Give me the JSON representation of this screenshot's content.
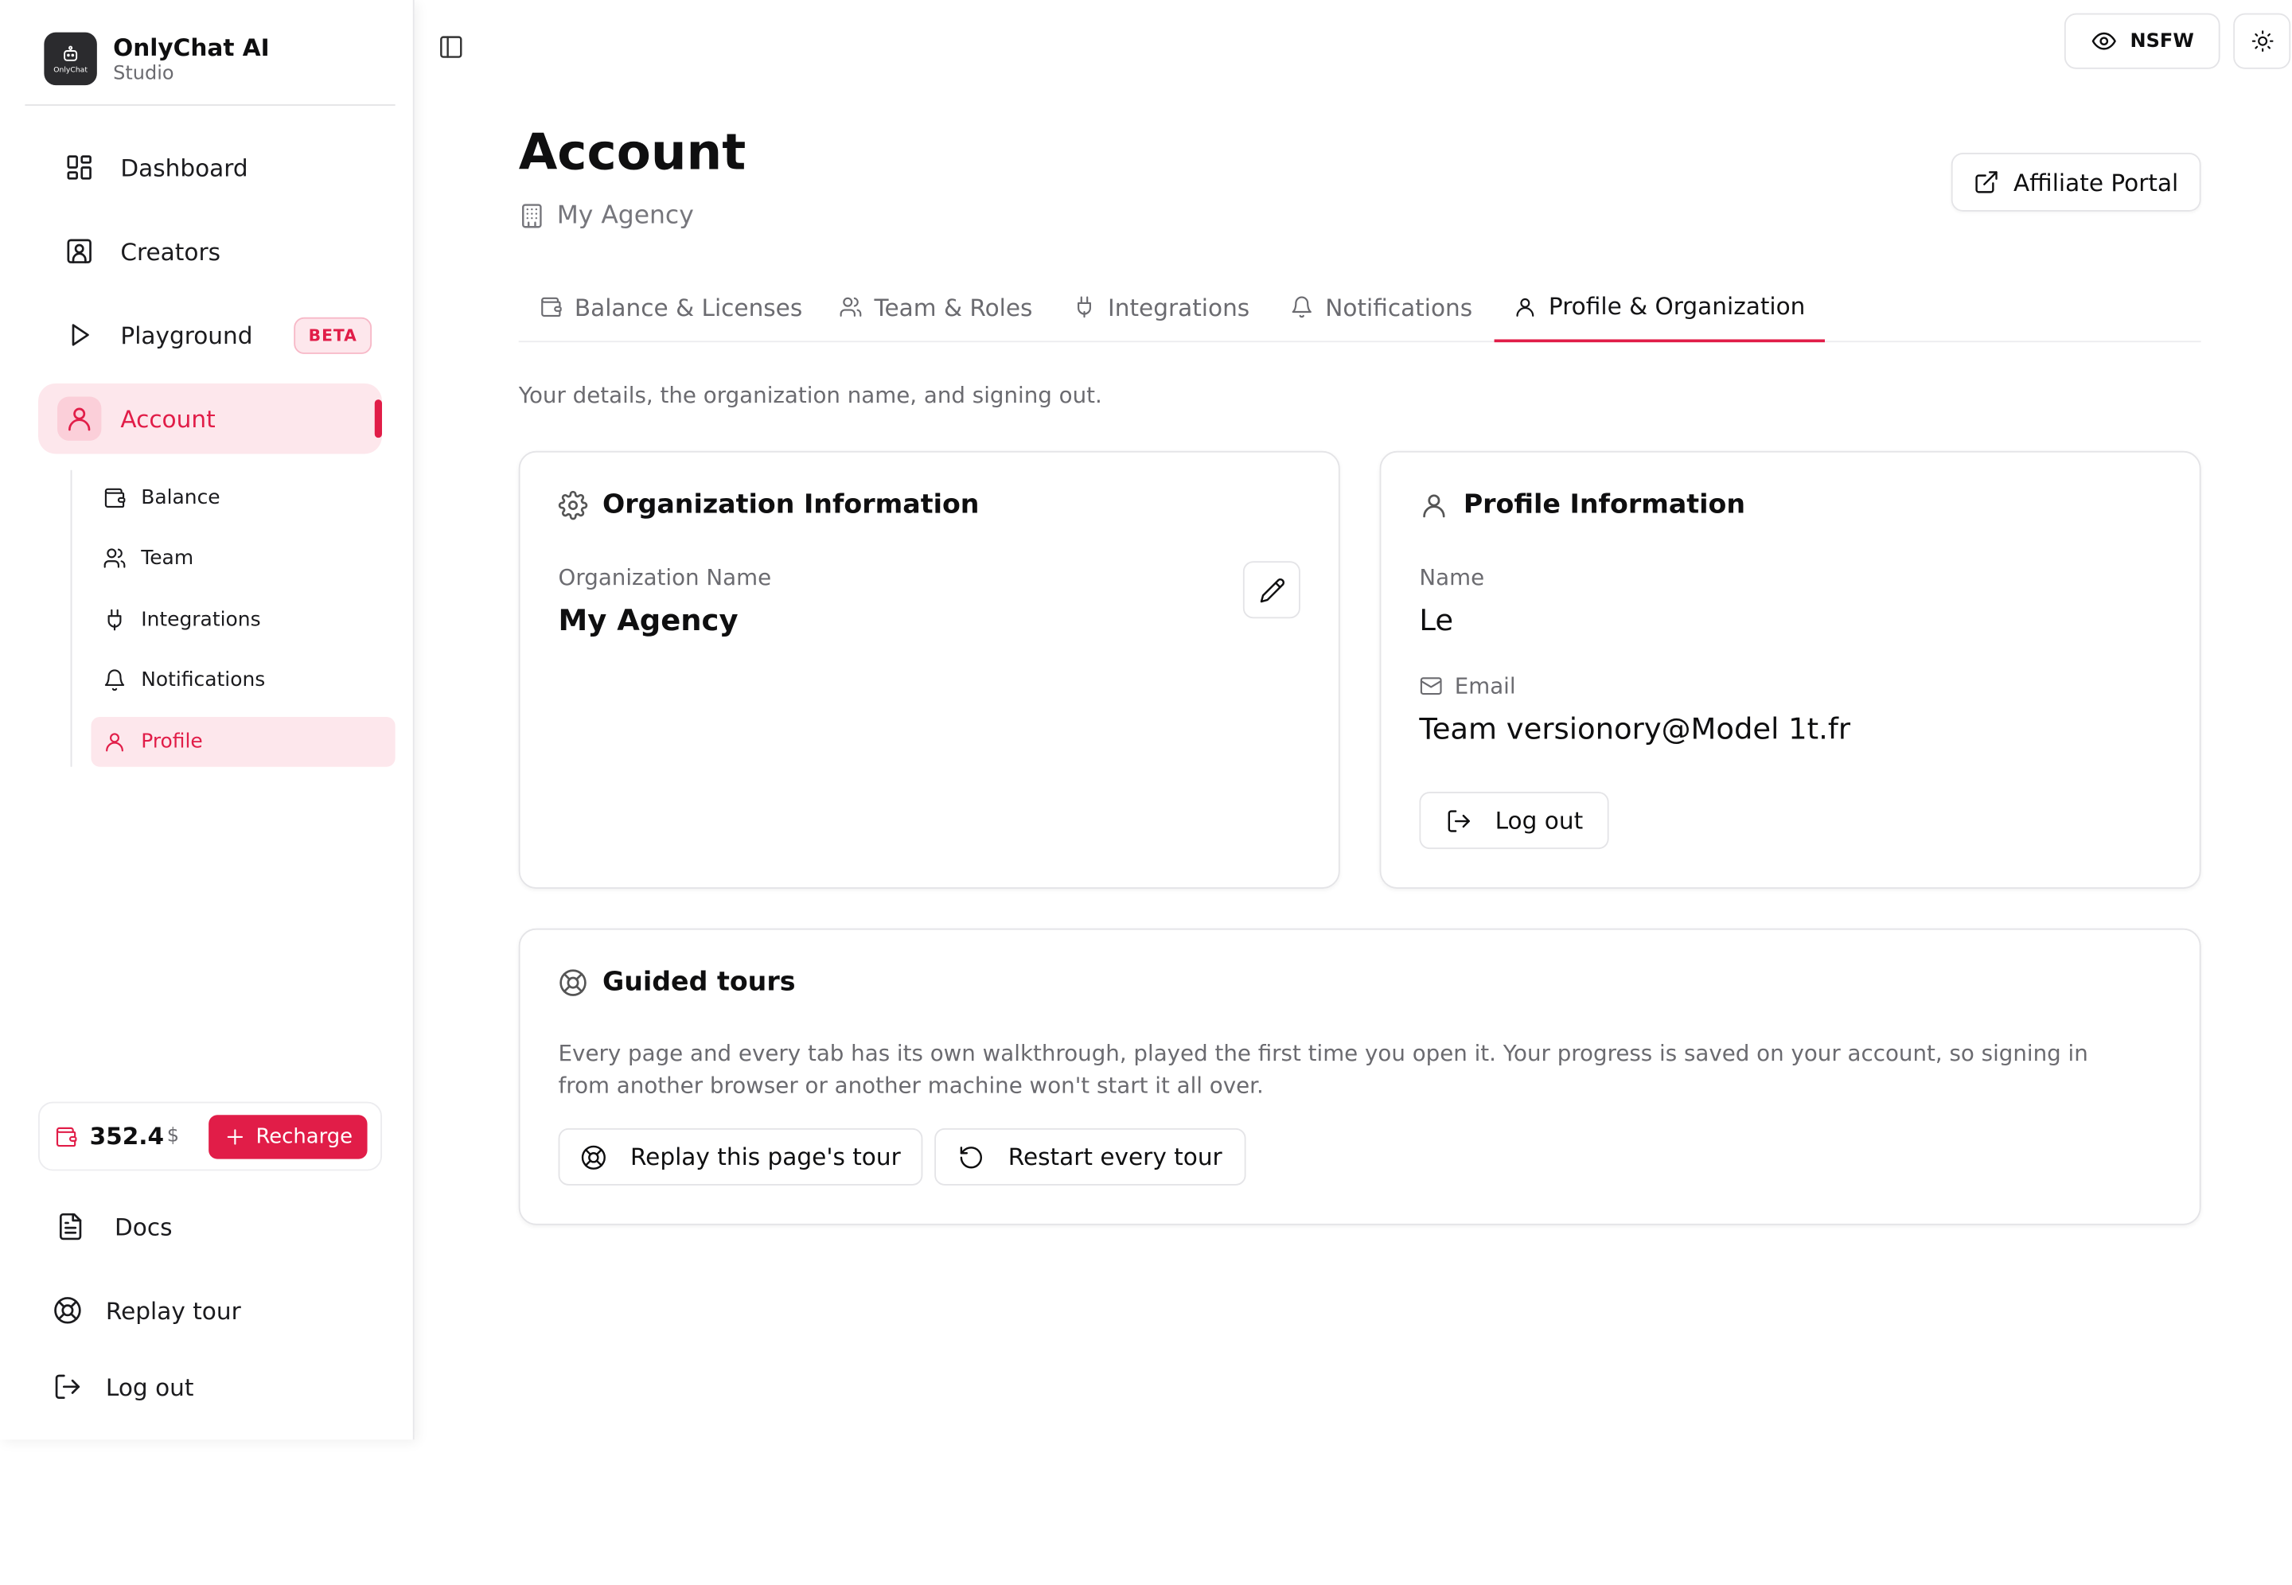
{
  "brand": {
    "name": "OnlyChat AI",
    "subtitle": "Studio",
    "logo_text": "OnlyChat"
  },
  "sidebar": {
    "items": [
      {
        "label": "Dashboard",
        "icon": "grid-icon"
      },
      {
        "label": "Creators",
        "icon": "user-square-icon"
      },
      {
        "label": "Playground",
        "icon": "play-icon",
        "badge": "BETA"
      },
      {
        "label": "Account",
        "icon": "user-icon",
        "active": true
      }
    ],
    "sub_items": [
      {
        "label": "Balance",
        "icon": "wallet-icon"
      },
      {
        "label": "Team",
        "icon": "users-icon"
      },
      {
        "label": "Integrations",
        "icon": "plug-icon"
      },
      {
        "label": "Notifications",
        "icon": "bell-icon"
      },
      {
        "label": "Profile",
        "icon": "user-icon",
        "active": true
      }
    ],
    "balance": {
      "value": "352.4",
      "unit": "$",
      "recharge_label": "Recharge"
    },
    "footer": [
      {
        "label": "Docs",
        "icon": "file-text-icon"
      },
      {
        "label": "Replay tour",
        "icon": "life-buoy-icon"
      },
      {
        "label": "Log out",
        "icon": "log-out-icon"
      }
    ]
  },
  "topbar": {
    "nsfw_label": "NSFW"
  },
  "header": {
    "title": "Account",
    "subtitle": "My Agency",
    "affiliate_label": "Affiliate Portal"
  },
  "tabs": [
    {
      "label": "Balance & Licenses",
      "icon": "wallet-icon"
    },
    {
      "label": "Team & Roles",
      "icon": "users-icon"
    },
    {
      "label": "Integrations",
      "icon": "plug-icon"
    },
    {
      "label": "Notifications",
      "icon": "bell-icon"
    },
    {
      "label": "Profile & Organization",
      "icon": "user-icon",
      "active": true
    }
  ],
  "tab_description": "Your details, the organization name, and signing out.",
  "org_card": {
    "title": "Organization Information",
    "name_label": "Organization Name",
    "name_value": "My Agency"
  },
  "profile_card": {
    "title": "Profile Information",
    "name_label": "Name",
    "name_value": "Le",
    "email_label": "Email",
    "email_value": "Team versionory@Model 1t.fr",
    "logout_label": "Log out"
  },
  "tours_card": {
    "title": "Guided tours",
    "description": "Every page and every tab has its own walkthrough, played the first time you open it. Your progress is saved on your account, so signing in from another browser or another machine won't start it all over.",
    "replay_label": "Replay this page's tour",
    "restart_label": "Restart every tour"
  },
  "colors": {
    "accent": "#e11d48",
    "accent_soft": "#fde7ec",
    "muted_text": "#6b6b70",
    "border": "#e4e4e7"
  }
}
